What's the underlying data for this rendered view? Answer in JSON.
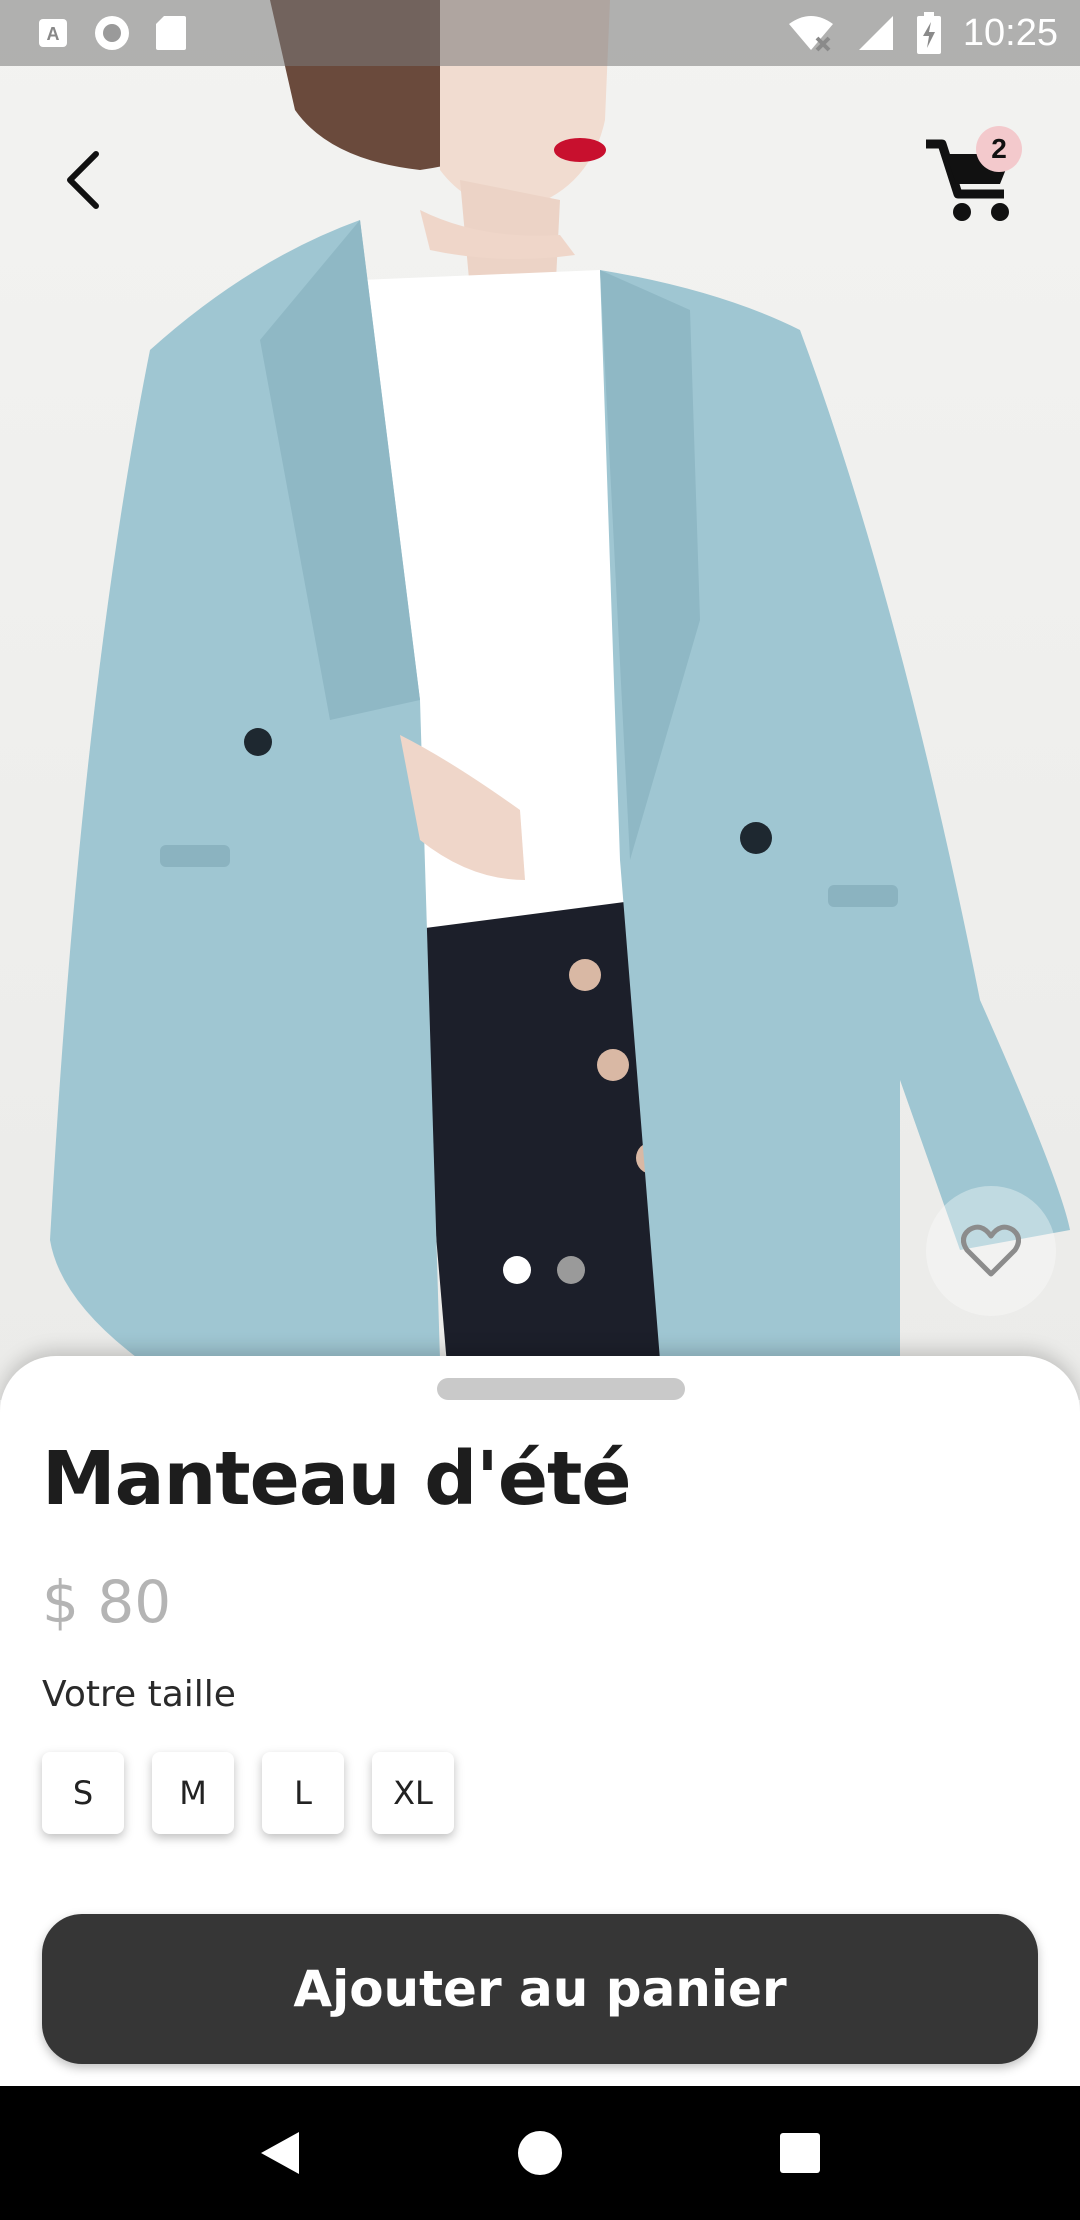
{
  "status_bar": {
    "time": "10:25",
    "left_icons": [
      "keyboard-icon",
      "circle-icon",
      "sd-card-icon"
    ],
    "right_icons": [
      "wifi-off-icon",
      "signal-icon",
      "battery-charging-icon"
    ]
  },
  "header": {
    "back_icon": "chevron-left-icon",
    "cart_icon": "cart-icon",
    "cart_count": "2"
  },
  "gallery": {
    "image_count": 2,
    "active_index": 0,
    "favorite_icon": "heart-outline-icon"
  },
  "product": {
    "title": "Manteau d'été",
    "price": "$ 80",
    "size_label": "Votre taille",
    "sizes": [
      "S",
      "M",
      "L",
      "XL"
    ]
  },
  "actions": {
    "add_to_cart_label": "Ajouter au panier"
  },
  "nav_bar": {
    "icons": [
      "nav-back-icon",
      "nav-home-icon",
      "nav-recents-icon"
    ]
  },
  "colors": {
    "button_bg": "#363636",
    "badge_bg": "#f3c9cc",
    "price_text": "#b4b4b4",
    "title_text": "#1d1d1d"
  }
}
